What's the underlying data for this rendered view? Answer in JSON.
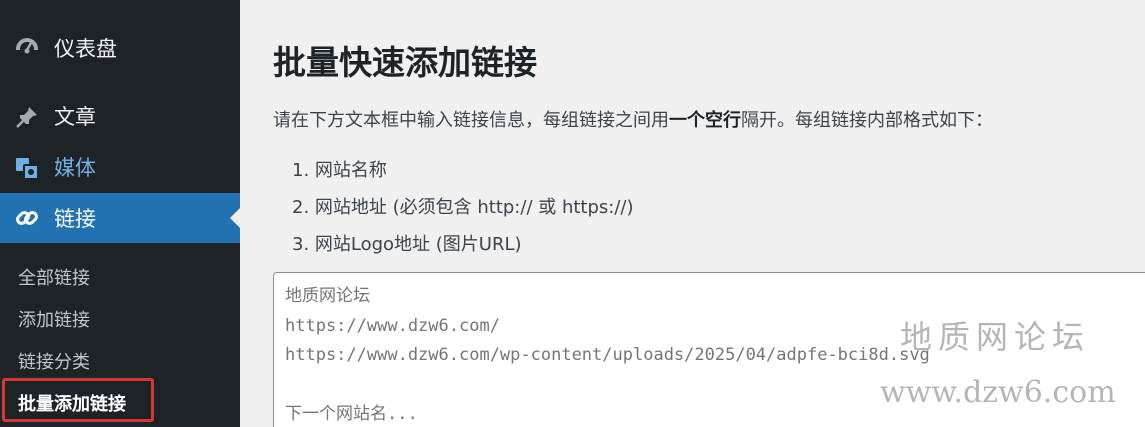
{
  "sidebar": {
    "menu": [
      {
        "label": "仪表盘",
        "icon": "dashboard-icon"
      },
      {
        "label": "文章",
        "icon": "pin-icon"
      },
      {
        "label": "媒体",
        "icon": "media-icon"
      },
      {
        "label": "链接",
        "icon": "link-icon"
      }
    ],
    "submenu": [
      {
        "label": "全部链接"
      },
      {
        "label": "添加链接"
      },
      {
        "label": "链接分类"
      },
      {
        "label": "批量添加链接"
      }
    ]
  },
  "main": {
    "title": "批量快速添加链接",
    "intro_before": "请在下方文本框中输入链接信息，每组链接之间用",
    "intro_bold": "一个空行",
    "intro_after": "隔开。每组链接内部格式如下：",
    "format_list": [
      "1. 网站名称",
      "2. 网站地址 (必须包含 http:// 或 https://)",
      "3. 网站Logo地址 (图片URL)"
    ],
    "textarea_placeholder": "地质网论坛\nhttps://www.dzw6.com/\nhttps://www.dzw6.com/wp-content/uploads/2025/04/adpfe-bci8d.svg\n\n下一个网站名..."
  },
  "watermark": {
    "line1": "地质网论坛",
    "line2": "www.dzw6.com"
  },
  "colors": {
    "sidebar_bg": "#1d2327",
    "active_menu_bg": "#2271b1",
    "highlight_border": "#d63638",
    "media_label": "#72aee6"
  }
}
